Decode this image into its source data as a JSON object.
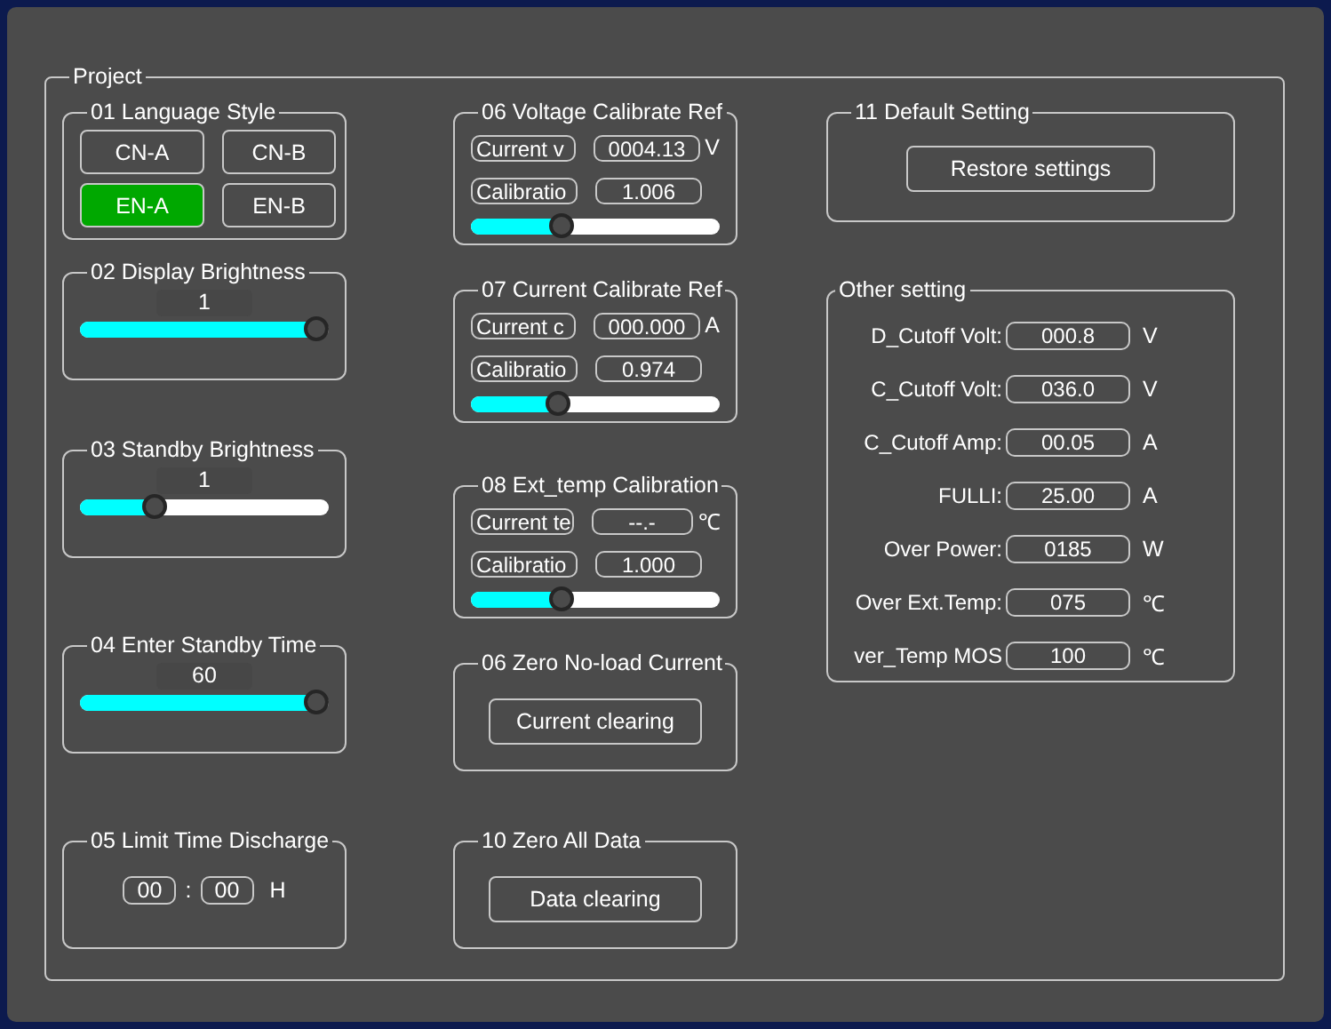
{
  "project": {
    "title": "Project"
  },
  "language": {
    "title": "01 Language Style",
    "options": [
      {
        "label": "CN-A",
        "selected": false
      },
      {
        "label": "CN-B",
        "selected": false
      },
      {
        "label": "EN-A",
        "selected": true
      },
      {
        "label": "EN-B",
        "selected": false
      }
    ]
  },
  "sliders": [
    {
      "title": "02 Display Brightness",
      "value": "1",
      "level": 1
    },
    {
      "title": "03 Standby Brightness",
      "value": "1",
      "level": 0.28
    },
    {
      "title": "04 Enter Standby Time",
      "value": "60",
      "level": 1
    }
  ],
  "limit_time": {
    "title": "05 Limit Time Discharge",
    "hours": "00",
    "separator": ":",
    "minutes": "00",
    "unit": "H"
  },
  "calibrations": [
    {
      "title": "06 Voltage Calibrate Ref",
      "reading_label": "Current v",
      "reading": "0004.13",
      "unit": "V",
      "factor_label": "Calibratio",
      "factor": "1.006",
      "level": 0.35
    },
    {
      "title": "07 Current Calibrate Ref",
      "reading_label": "Current c",
      "reading": "000.000",
      "unit": "A",
      "factor_label": "Calibratio",
      "factor": "0.974",
      "level": 0.33
    },
    {
      "title": "08 Ext_temp Calibration",
      "reading_label": "Current te",
      "reading": "--.-",
      "unit": "℃",
      "factor_label": "Calibratio",
      "factor": "1.000",
      "level": 0.35
    }
  ],
  "zero_current": {
    "title": "06 Zero No-load Current",
    "button": "Current clearing"
  },
  "zero_all": {
    "title": "10 Zero All Data",
    "button": "Data clearing"
  },
  "default_setting": {
    "title": "11 Default Setting",
    "button": "Restore settings"
  },
  "other_setting": {
    "title": "Other setting",
    "rows": [
      {
        "label": "D_Cutoff Volt:",
        "value": "000.8",
        "unit": "V"
      },
      {
        "label": "C_Cutoff Volt:",
        "value": "036.0",
        "unit": "V"
      },
      {
        "label": "C_Cutoff Amp:",
        "value": "00.05",
        "unit": "A"
      },
      {
        "label": "FULLI:",
        "value": "25.00",
        "unit": "A"
      },
      {
        "label": "Over Power:",
        "value": "0185",
        "unit": "W"
      },
      {
        "label": "Over Ext.Temp:",
        "value": "075",
        "unit": "℃"
      },
      {
        "label": "ver_Temp MOS",
        "value": "100",
        "unit": "℃"
      }
    ]
  }
}
